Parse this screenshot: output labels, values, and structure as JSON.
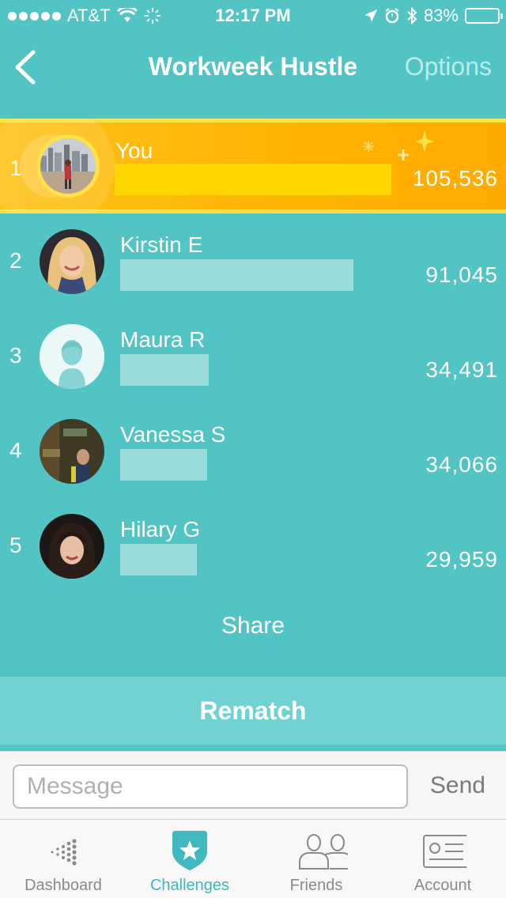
{
  "status_bar": {
    "carrier": "AT&T",
    "time": "12:17 PM",
    "battery": "83%",
    "battery_level": 0.83
  },
  "nav": {
    "title": "Workweek Hustle",
    "options_label": "Options"
  },
  "leaderboard": [
    {
      "rank": "1",
      "name": "You",
      "steps": "105,536",
      "progress": 1.0
    },
    {
      "rank": "2",
      "name": "Kirstin E",
      "steps": "91,045",
      "progress": 0.863
    },
    {
      "rank": "3",
      "name": "Maura R",
      "steps": "34,491",
      "progress": 0.327
    },
    {
      "rank": "4",
      "name": "Vanessa S",
      "steps": "34,066",
      "progress": 0.323
    },
    {
      "rank": "5",
      "name": "Hilary G",
      "steps": "29,959",
      "progress": 0.284
    }
  ],
  "share_label": "Share",
  "rematch_label": "Rematch",
  "compose": {
    "placeholder": "Message",
    "send_label": "Send"
  },
  "tabs": [
    {
      "label": "Dashboard",
      "icon": "dashboard-dots-icon"
    },
    {
      "label": "Challenges",
      "icon": "star-badge-icon"
    },
    {
      "label": "Friends",
      "icon": "friends-icon"
    },
    {
      "label": "Account",
      "icon": "id-card-icon"
    }
  ],
  "colors": {
    "accent": "#52C4C4",
    "highlight": "#FFB300",
    "active_tab": "#41B8C0"
  }
}
